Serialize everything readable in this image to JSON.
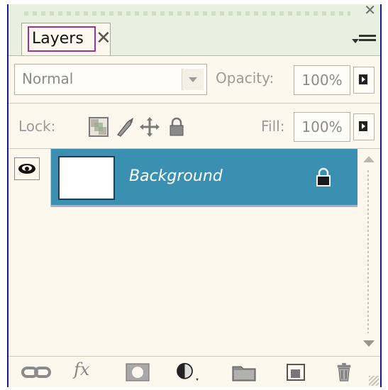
{
  "panel": {
    "tab_label": "Layers",
    "tab_close_glyph": "✕",
    "close_glyph": "✕"
  },
  "options": {
    "blend_mode": "Normal",
    "opacity_label": "Opacity:",
    "opacity_value": "100%",
    "lock_label": "Lock:",
    "fill_label": "Fill:",
    "fill_value": "100%"
  },
  "layers": [
    {
      "name": "Background",
      "visible": true,
      "locked": true,
      "selected": true
    }
  ],
  "toolbar": {
    "fx_label": "fx",
    "icons": [
      "link-layers-icon",
      "fx-icon",
      "layer-mask-icon",
      "adjustment-layer-icon",
      "new-group-icon",
      "new-layer-icon",
      "trash-icon"
    ]
  },
  "colors": {
    "panel_bg": "#fdf8ee",
    "selected_row": "#3b8fb0",
    "tab_highlight": "#9b2fae",
    "border_accent": "#1a1a8a"
  }
}
